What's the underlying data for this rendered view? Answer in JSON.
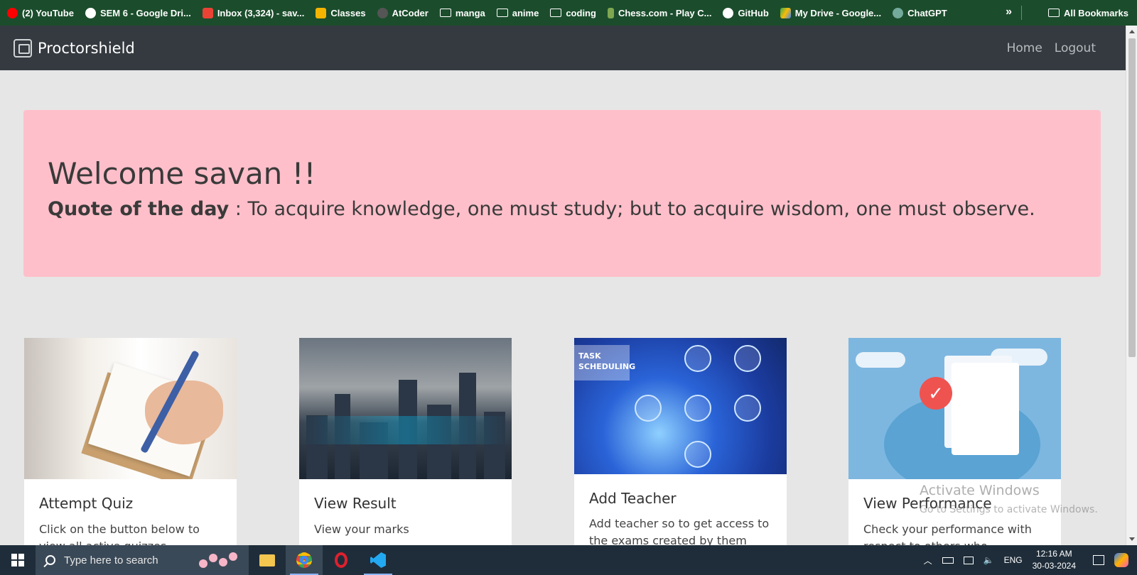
{
  "bookmarks": [
    {
      "label": "(2) YouTube",
      "icon": "youtube-icon",
      "color": "#ff0000"
    },
    {
      "label": "SEM 6 - Google Dri...",
      "icon": "google-icon",
      "color": "#ffffff"
    },
    {
      "label": "Inbox (3,324) - sav...",
      "icon": "gmail-icon",
      "color": "#ea4335"
    },
    {
      "label": "Classes",
      "icon": "classroom-icon",
      "color": "#f4b400"
    },
    {
      "label": "AtCoder",
      "icon": "atcoder-icon",
      "color": "#444444"
    },
    {
      "label": "manga",
      "icon": "folder-icon"
    },
    {
      "label": "anime",
      "icon": "folder-icon"
    },
    {
      "label": "coding",
      "icon": "folder-icon"
    },
    {
      "label": "Chess.com - Play C...",
      "icon": "chess-icon",
      "color": "#7fa650"
    },
    {
      "label": "GitHub",
      "icon": "github-icon",
      "color": "#ffffff"
    },
    {
      "label": "My Drive - Google...",
      "icon": "drive-icon",
      "color": "#34a853"
    },
    {
      "label": "ChatGPT",
      "icon": "chatgpt-icon",
      "color": "#74aa9c"
    }
  ],
  "bookmarks_more": "»",
  "all_bookmarks": "All Bookmarks",
  "navbar": {
    "brand": "Proctorshield",
    "links": [
      "Home",
      "Logout"
    ]
  },
  "welcome": {
    "heading": "Welcome savan !!",
    "quote_label": "Quote of the day",
    "quote_text": " : To acquire knowledge, one must study; but to acquire wisdom, one must observe."
  },
  "cards": [
    {
      "title": "Attempt Quiz",
      "text": "Click on the button below to view all active quizzes"
    },
    {
      "title": "View Result",
      "text": "View your marks"
    },
    {
      "title": "Add Teacher",
      "text": "Add teacher so to get access to the exams created by them",
      "image_tag": "TASK SCHEDULING"
    },
    {
      "title": "View Performance",
      "text": "Check your performance with respect to others who attempted"
    }
  ],
  "watermark": {
    "line1": "Activate Windows",
    "line2": "Go to Settings to activate Windows."
  },
  "taskbar": {
    "search_placeholder": "Type here to search",
    "language": "ENG",
    "time": "12:16 AM",
    "date": "30-03-2024"
  },
  "colors": {
    "bookmark_bar": "#1b4d2c",
    "navbar": "#343a40",
    "jumbotron": "#ffbfca",
    "page_bg": "#e6e6e6",
    "taskbar": "#1f2d3a"
  }
}
